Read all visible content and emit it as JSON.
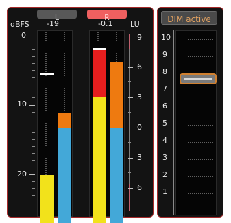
{
  "channels": {
    "left_label": "L",
    "right_label": "R",
    "left_value": "-19",
    "right_value": "-0.1"
  },
  "scales": {
    "dbfs_unit": "dBFS",
    "lu_unit": "LU",
    "dbfs_ticks": [
      "0",
      "10",
      "20"
    ],
    "lu_ticks": [
      "9",
      "6",
      "3",
      "0",
      "3",
      "6"
    ]
  },
  "dim": {
    "button_label": "DIM active",
    "scale_ticks": [
      "10",
      "9",
      "8",
      "7",
      "6",
      "5",
      "4",
      "3",
      "2",
      "1"
    ],
    "slider_value": 8
  },
  "colors": {
    "panel_border": "#a52a2a",
    "yellow": "#f2e21b",
    "blue": "#43a8d8",
    "orange": "#ee7a10",
    "red": "#e51e1e",
    "r_button": "#ef6060",
    "dim_text": "#e0a060"
  }
}
